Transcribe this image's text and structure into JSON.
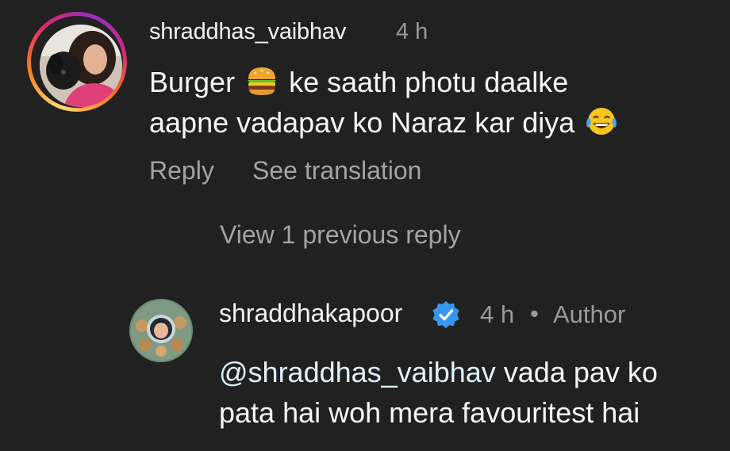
{
  "colors": {
    "background": "#212121",
    "primary_text": "#f7f7f7",
    "secondary_text": "#a3a3a3",
    "verified_blue": "#3797f0",
    "story_ring": [
      "#feda75",
      "#fa7e1e",
      "#d62976",
      "#962fbf"
    ]
  },
  "comment": {
    "username": "shraddhas_vaibhav",
    "time": "4 h",
    "text_line1_before_emoji": "Burger ",
    "text_line1_emoji": "burger-emoji",
    "text_line1_after_emoji": " ke saath photu daalke",
    "text_line2": "aapne vadapav ko Naraz kar diya ",
    "text_line2_emoji": "tears-of-joy-emoji",
    "reply_label": "Reply",
    "see_translation_label": "See translation"
  },
  "view_previous_label": "View 1 previous reply",
  "reply": {
    "username": "shraddhakapoor",
    "verified_icon": "verified-badge-icon",
    "time": "4 h",
    "separator": "•",
    "author_label": "Author",
    "mention": "@shraddhas_vaibhav",
    "text_line1_rest": " vada pav ko",
    "text_line2": "pata hai woh mera favouritest hai"
  }
}
